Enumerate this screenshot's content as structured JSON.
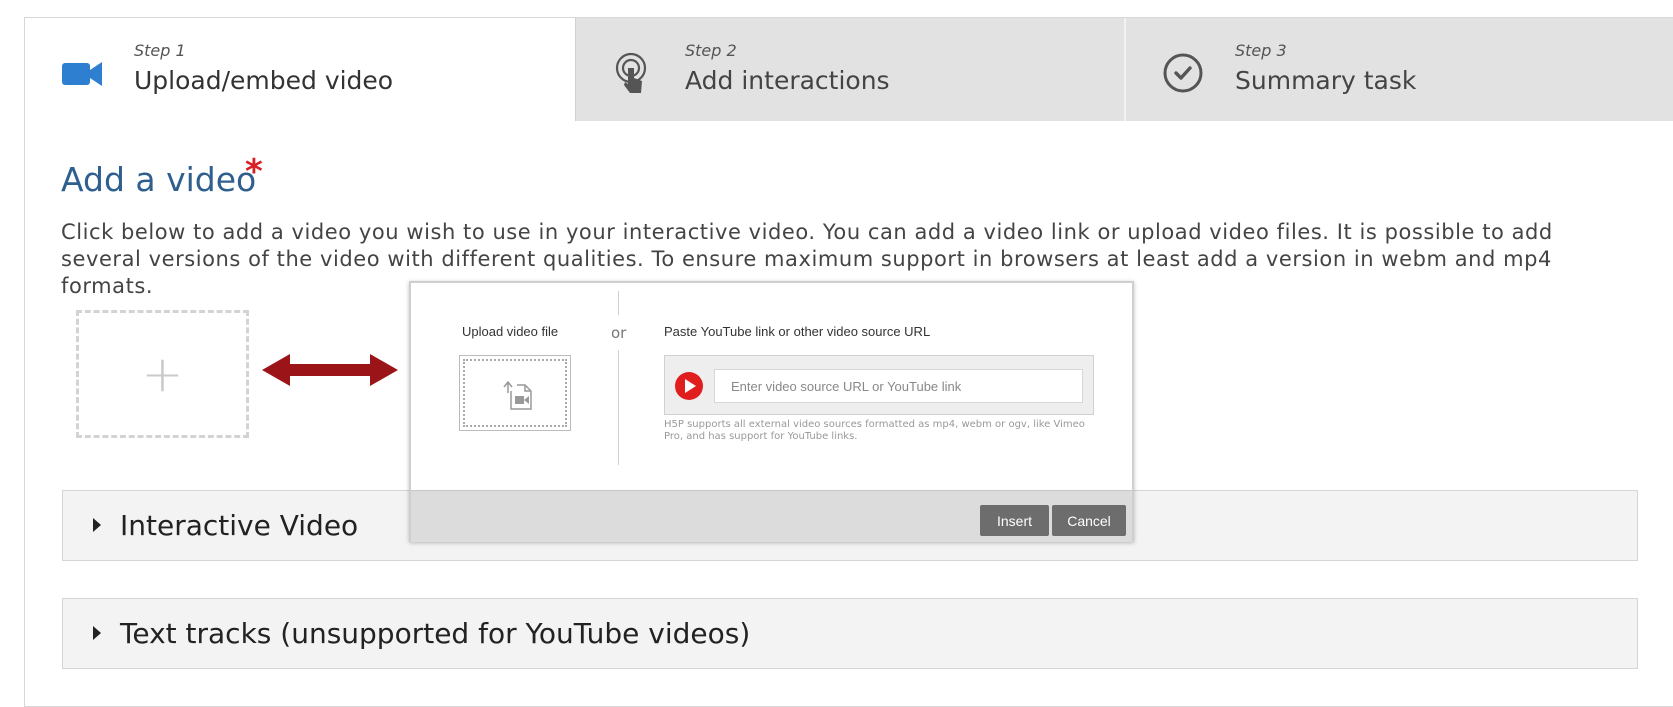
{
  "steps": [
    {
      "number": "Step 1",
      "title": "Upload/embed video",
      "icon": "video-camera-icon"
    },
    {
      "number": "Step 2",
      "title": "Add interactions",
      "icon": "touch-pointer-icon"
    },
    {
      "number": "Step 3",
      "title": "Summary task",
      "icon": "check-circle-icon"
    }
  ],
  "section": {
    "title": "Add a video",
    "required_mark": "*",
    "description": "Click below to add a video you wish to use in your interactive video. You can add a video link or upload video files. It is possible to add several versions of the video with different qualities. To ensure maximum support in browsers at least add a version in webm and mp4 formats.",
    "add_symbol": "+"
  },
  "dialog": {
    "upload_label": "Upload video file",
    "or_label": "or",
    "url_label": "Paste YouTube link or other video source URL",
    "url_placeholder": "Enter video source URL or YouTube link",
    "help_text": "H5P supports all external video sources formatted as mp4, webm or ogv, like Vimeo Pro, and has support for YouTube links.",
    "insert_label": "Insert",
    "cancel_label": "Cancel"
  },
  "groups": [
    {
      "label": "Interactive Video"
    },
    {
      "label": "Text tracks (unsupported for YouTube videos)"
    }
  ],
  "colors": {
    "accent_blue": "#2f7fd1",
    "heading_blue": "#2f5f8f",
    "required_red": "#d81f26",
    "arrow_red": "#9b1518",
    "play_red": "#e01e1e"
  }
}
